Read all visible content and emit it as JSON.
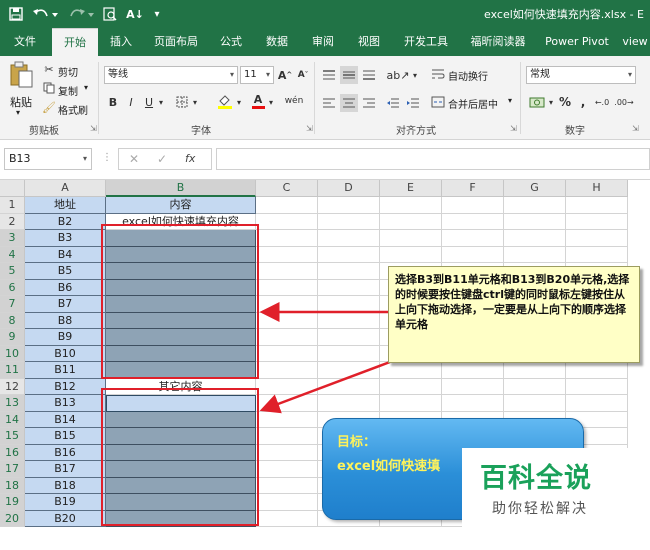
{
  "window": {
    "title": "excel如何快速填充内容.xlsx - E"
  },
  "quick_access": {
    "icons": [
      "save-icon",
      "undo-icon",
      "redo-icon",
      "print-preview-icon",
      "sort-icon",
      "customize-icon"
    ]
  },
  "tabs": [
    {
      "label": "文件"
    },
    {
      "label": "开始"
    },
    {
      "label": "插入"
    },
    {
      "label": "页面布局"
    },
    {
      "label": "公式"
    },
    {
      "label": "数据"
    },
    {
      "label": "审阅"
    },
    {
      "label": "视图"
    },
    {
      "label": "开发工具"
    },
    {
      "label": "福昕阅读器"
    },
    {
      "label": "Power Pivot"
    },
    {
      "label": "view"
    }
  ],
  "ribbon": {
    "clipboard": {
      "paste": "粘贴",
      "cut": "剪切",
      "copy": "复制",
      "format_painter": "格式刷",
      "label": "剪贴板"
    },
    "font": {
      "name": "等线",
      "size": "11",
      "label": "字体"
    },
    "alignment": {
      "wrap": "自动换行",
      "merge": "合并后居中",
      "label": "对齐方式"
    },
    "number": {
      "format": "常规",
      "label": "数字"
    }
  },
  "formula_bar": {
    "name_box": "B13",
    "formula": ""
  },
  "sheet": {
    "columns": [
      "A",
      "B",
      "C",
      "D",
      "E",
      "F",
      "G",
      "H"
    ],
    "rows": [
      {
        "num": "1",
        "a": "地址",
        "b": "内容"
      },
      {
        "num": "2",
        "a": "B2",
        "b": "excel如何快速填充内容"
      },
      {
        "num": "3",
        "a": "B3",
        "b": ""
      },
      {
        "num": "4",
        "a": "B4",
        "b": ""
      },
      {
        "num": "5",
        "a": "B5",
        "b": ""
      },
      {
        "num": "6",
        "a": "B6",
        "b": ""
      },
      {
        "num": "7",
        "a": "B7",
        "b": ""
      },
      {
        "num": "8",
        "a": "B8",
        "b": ""
      },
      {
        "num": "9",
        "a": "B9",
        "b": ""
      },
      {
        "num": "10",
        "a": "B10",
        "b": ""
      },
      {
        "num": "11",
        "a": "B11",
        "b": ""
      },
      {
        "num": "12",
        "a": "B12",
        "b": "其它内容"
      },
      {
        "num": "13",
        "a": "B13",
        "b": ""
      },
      {
        "num": "14",
        "a": "B14",
        "b": ""
      },
      {
        "num": "15",
        "a": "B15",
        "b": ""
      },
      {
        "num": "16",
        "a": "B16",
        "b": ""
      },
      {
        "num": "17",
        "a": "B17",
        "b": ""
      },
      {
        "num": "18",
        "a": "B18",
        "b": ""
      },
      {
        "num": "19",
        "a": "B19",
        "b": ""
      },
      {
        "num": "20",
        "a": "B20",
        "b": ""
      }
    ]
  },
  "callout": {
    "text": "选择B3到B11单元格和B13到B20单元格,选择的时候要按住键盘ctrl键的同时鼠标左键按住从上向下拖动选择，一定要是从上向下的顺序选择单元格"
  },
  "goal": {
    "title": "目标：",
    "text": "excel如何快速填"
  },
  "watermark": {
    "big": "百科全说",
    "small": "助你轻松解决"
  },
  "colors": {
    "excel_green": "#217346",
    "selection": "#8ea3b5",
    "header_fill": "#c5d9f1",
    "annotation_red": "#e0202a",
    "callout_fill": "#ffffc6"
  }
}
